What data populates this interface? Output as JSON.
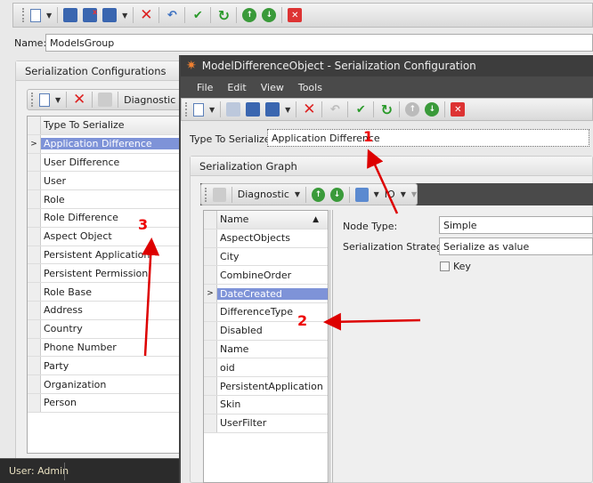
{
  "main": {
    "name_label": "Name:",
    "name_value": "ModelsGroup",
    "group_title": "Serialization Configurations",
    "toolbar_diagnostic": "Diagnostic",
    "grid_header": "Type To Serialize",
    "rows": [
      "Application Difference",
      "User Difference",
      "User",
      "Role",
      "Role Difference",
      "Aspect Object",
      "Persistent Application",
      "Persistent Permission",
      "Role Base",
      "Address",
      "Country",
      "Phone Number",
      "Party",
      "Organization",
      "Person"
    ],
    "status": "User: Admin"
  },
  "dialog": {
    "title": "ModelDifferenceObject - Serialization Configuration",
    "menu": [
      "File",
      "Edit",
      "View",
      "Tools"
    ],
    "type_label": "Type To Serialize:",
    "type_value": "Application Difference",
    "group_title": "Serialization Graph",
    "toolbar_diagnostic": "Diagnostic",
    "toolbar_io": "IO",
    "grid_header": "Name",
    "sort_icon": "▲",
    "rows": [
      "AspectObjects",
      "City",
      "CombineOrder",
      "DateCreated",
      "DifferenceType",
      "Disabled",
      "Name",
      "oid",
      "PersistentApplication",
      "Skin",
      "UserFilter"
    ],
    "node_type_label": "Node Type:",
    "node_type_value": "Simple",
    "strategy_label": "Serialization Strategy:",
    "strategy_value": "Serialize as value",
    "key_label": "Key"
  },
  "annotations": [
    "1",
    "2",
    "3"
  ]
}
